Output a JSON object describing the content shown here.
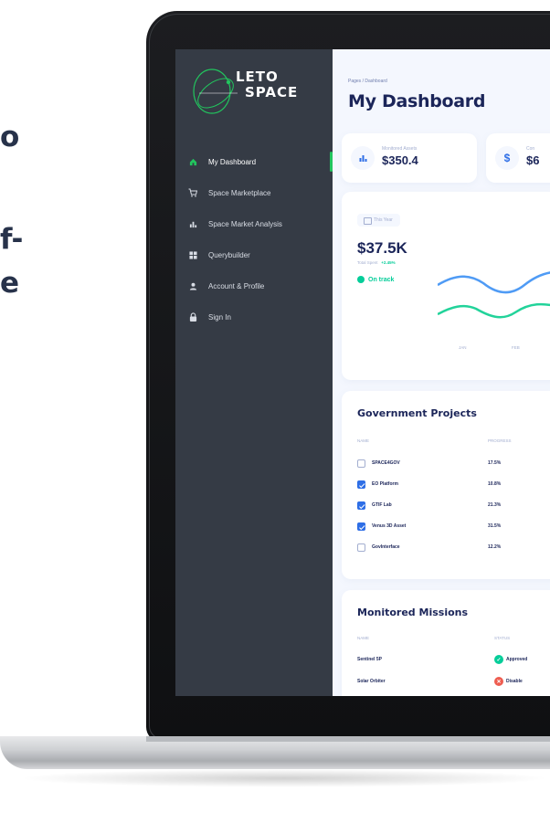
{
  "hero": {
    "frag1": "o",
    "frag2": "f-",
    "frag3": "e"
  },
  "brand": {
    "line1": "LETO",
    "line2": "SPACE"
  },
  "sidebar": {
    "items": [
      {
        "label": "My Dashboard",
        "icon": "home-icon",
        "active": true
      },
      {
        "label": "Space Marketplace",
        "icon": "cart-icon",
        "active": false
      },
      {
        "label": "Space Market Analysis",
        "icon": "bar-chart-icon",
        "active": false
      },
      {
        "label": "Querybuilder",
        "icon": "grid-icon",
        "active": false
      },
      {
        "label": "Account & Profile",
        "icon": "person-icon",
        "active": false
      },
      {
        "label": "Sign In",
        "icon": "lock-icon",
        "active": false
      }
    ]
  },
  "header": {
    "breadcrumb": "Pages / Dashboard",
    "title": "My Dashboard"
  },
  "stats": [
    {
      "label": "Monitored Assets",
      "value": "$350.4",
      "icon": "bar-chart-icon"
    },
    {
      "label": "Con",
      "value": "$6",
      "icon": "dollar-icon"
    }
  ],
  "spend": {
    "period": "This Year",
    "value": "$37.5K",
    "sub": "Total Spent",
    "delta": "+2.45%",
    "status": "On track",
    "months": [
      "JAN",
      "FEB"
    ]
  },
  "gov_projects": {
    "title": "Government Projects",
    "columns": [
      "NAME",
      "PROGRESS"
    ],
    "rows": [
      {
        "name": "SPACE4GOV",
        "progress": "17.5%",
        "checked": false
      },
      {
        "name": "EO Platform",
        "progress": "10.8%",
        "checked": true
      },
      {
        "name": "GTIF Lab",
        "progress": "21.3%",
        "checked": true
      },
      {
        "name": "Venus 3D Asset",
        "progress": "31.5%",
        "checked": true
      },
      {
        "name": "GovInterface",
        "progress": "12.2%",
        "checked": false
      }
    ]
  },
  "missions": {
    "title": "Monitored Missions",
    "columns": [
      "NAME",
      "STATUS"
    ],
    "rows": [
      {
        "name": "Sentinel 5P",
        "status": "Approved"
      },
      {
        "name": "Solar Orbiter",
        "status": "Disable"
      }
    ]
  },
  "colors": {
    "accent": "#2e6ee6",
    "success": "#05cd99",
    "danger": "#ee5d50",
    "sidebar": "#353b45"
  }
}
